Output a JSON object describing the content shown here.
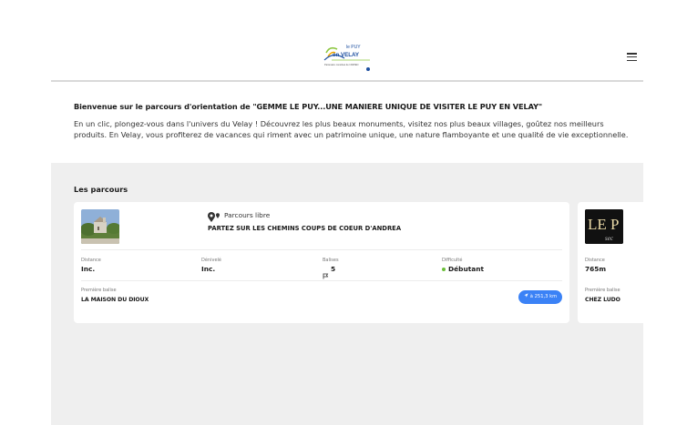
{
  "header": {
    "logo_top": "le PUY",
    "logo_bottom": "en VELAY",
    "logo_tagline": "Partenaire constitué de l'ARPEN"
  },
  "intro": {
    "title": "Bienvenue sur le parcours d'orientation de \"GEMME LE PUY...UNE MANIERE UNIQUE DE VISITER LE PUY EN VELAY\"",
    "text": "En un clic, plongez-vous dans l'univers du Velay ! Découvrez les plus beaux monuments, visitez nos plus beaux villages, goûtez nos meilleurs produits. En Velay, vous profiterez de vacances qui riment avec un patrimoine unique, une nature flamboyante et une qualité de vie exceptionnelle."
  },
  "routes": {
    "title": "Les parcours",
    "cards": [
      {
        "type": "Parcours libre",
        "name": "PARTEZ SUR LES CHEMINS COUPS DE COEUR D'ANDREA",
        "distance_label": "Distance",
        "distance_value": "Inc.",
        "elevation_label": "Dénivelé",
        "elevation_value": "Inc.",
        "beacons_label": "Balises",
        "beacons_value": "5",
        "difficulty_label": "Difficulté",
        "difficulty_value": "Débutant",
        "first_beacon_label": "Première balise",
        "first_beacon_value": "LA MAISON DU DIOUX",
        "away_distance": "à 251,3 km"
      },
      {
        "thumb_text": "LE P",
        "thumb_subtext": "sec",
        "distance_label": "Distance",
        "distance_value": "765m",
        "first_beacon_label": "Première balise",
        "first_beacon_value": "CHEZ LUDO"
      }
    ]
  },
  "colors": {
    "accent": "#3b82f6",
    "difficulty_easy": "#6bbf3a",
    "section_bg": "#efefef"
  },
  "icons": {
    "menu": "hamburger-menu-icon",
    "pin": "map-pin-icon",
    "flag": "flag-icon",
    "nav": "navigation-arrow-icon"
  }
}
